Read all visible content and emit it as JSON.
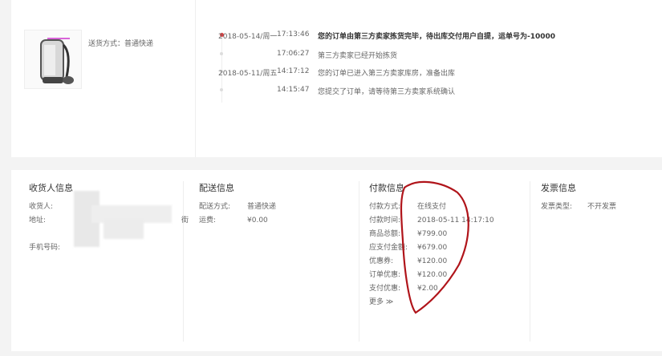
{
  "top": {
    "shipping_label": "送货方式：普通快递",
    "timeline": [
      {
        "date": "2018-05-14/周一",
        "time": "17:13:46",
        "text": "您的订单由第三方卖家拣货完毕，待出库交付用户自提，运单号为-10000",
        "active": true
      },
      {
        "date": "",
        "time": "17:06:27",
        "text": "第三方卖家已经开始拣货"
      },
      {
        "date": "2018-05-11/周五",
        "time": "14:17:12",
        "text": "您的订单已进入第三方卖家库房，准备出库"
      },
      {
        "date": "",
        "time": "14:15:47",
        "text": "您提交了订单，请等待第三方卖家系统确认"
      }
    ]
  },
  "receiver": {
    "title": "收货人信息",
    "name_label": "收货人:",
    "address_label": "地址:",
    "address_tail": "街",
    "phone_label": "手机号码:"
  },
  "delivery": {
    "title": "配送信息",
    "method_label": "配送方式:",
    "method_value": "普通快递",
    "fee_label": "运费:",
    "fee_value": "¥0.00"
  },
  "payment": {
    "title": "付款信息",
    "rows": [
      {
        "k": "付款方式:",
        "v": "在线支付"
      },
      {
        "k": "付款时间:",
        "v": "2018-05-11 14:17:10"
      },
      {
        "k": "商品总额:",
        "v": "¥799.00"
      },
      {
        "k": "应支付金额:",
        "v": "¥679.00"
      },
      {
        "k": "优惠券:",
        "v": "¥120.00"
      },
      {
        "k": "订单优惠:",
        "v": "¥120.00"
      },
      {
        "k": "支付优惠:",
        "v": "¥2.00"
      }
    ],
    "more": "更多 ≫"
  },
  "invoice": {
    "title": "发票信息",
    "type_label": "发票类型:",
    "type_value": "不开发票"
  },
  "colors": {
    "accent": "#e4393c",
    "annotation": "#b0141a"
  }
}
